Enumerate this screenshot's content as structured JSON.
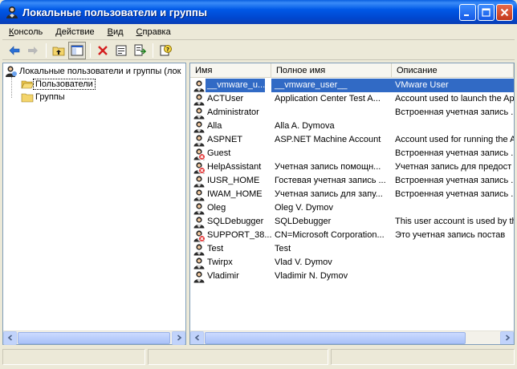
{
  "window": {
    "title": "Локальные пользователи и группы"
  },
  "menu": [
    "Консоль",
    "Действие",
    "Вид",
    "Справка"
  ],
  "toolbar": [
    "back-icon",
    "forward-icon",
    "up-folder-icon",
    "show-tree-icon",
    "delete-icon",
    "properties-icon",
    "export-list-icon",
    "help-icon"
  ],
  "tree": {
    "root": "Локальные пользователи и группы (лок",
    "items": [
      "Пользователи",
      "Группы"
    ]
  },
  "list": {
    "columns": [
      "Имя",
      "Полное имя",
      "Описание"
    ],
    "rows": [
      {
        "name": "__vmware_u...",
        "full": "__vmware_user__",
        "desc": "VMware User",
        "disabled": false,
        "selected": true
      },
      {
        "name": "ACTUser",
        "full": "Application Center Test A...",
        "desc": "Account used to launch the Ap",
        "disabled": false
      },
      {
        "name": "Administrator",
        "full": "",
        "desc": "Встроенная учетная запись ...",
        "disabled": false
      },
      {
        "name": "Alla",
        "full": "Alla A. Dymova",
        "desc": "",
        "disabled": false
      },
      {
        "name": "ASPNET",
        "full": "ASP.NET Machine Account",
        "desc": "Account used for running the A",
        "disabled": false
      },
      {
        "name": "Guest",
        "full": "",
        "desc": "Встроенная учетная запись ...",
        "disabled": true
      },
      {
        "name": "HelpAssistant",
        "full": "Учетная запись помощн...",
        "desc": "Учетная запись для предост",
        "disabled": true
      },
      {
        "name": "IUSR_HOME",
        "full": "Гостевая учетная запись ...",
        "desc": "Встроенная учетная запись ...",
        "disabled": false
      },
      {
        "name": "IWAM_HOME",
        "full": "Учетная запись для запу...",
        "desc": "Встроенная учетная запись ...",
        "disabled": false
      },
      {
        "name": "Oleg",
        "full": "Oleg V. Dymov",
        "desc": "",
        "disabled": false
      },
      {
        "name": "SQLDebugger",
        "full": "SQLDebugger",
        "desc": "This user account is used by th",
        "disabled": false
      },
      {
        "name": "SUPPORT_38...",
        "full": "CN=Microsoft Corporation...",
        "desc": "Это учетная запись постав",
        "disabled": true
      },
      {
        "name": "Test",
        "full": "Test",
        "desc": "",
        "disabled": false
      },
      {
        "name": "Twirpx",
        "full": "Vlad V. Dymov",
        "desc": "",
        "disabled": false
      },
      {
        "name": "Vladimir",
        "full": "Vladimir N. Dymov",
        "desc": "",
        "disabled": false
      }
    ]
  },
  "colors": {
    "titlebar": "#0054e3",
    "selection": "#316ac5",
    "disabled_mark": "#e02020"
  }
}
